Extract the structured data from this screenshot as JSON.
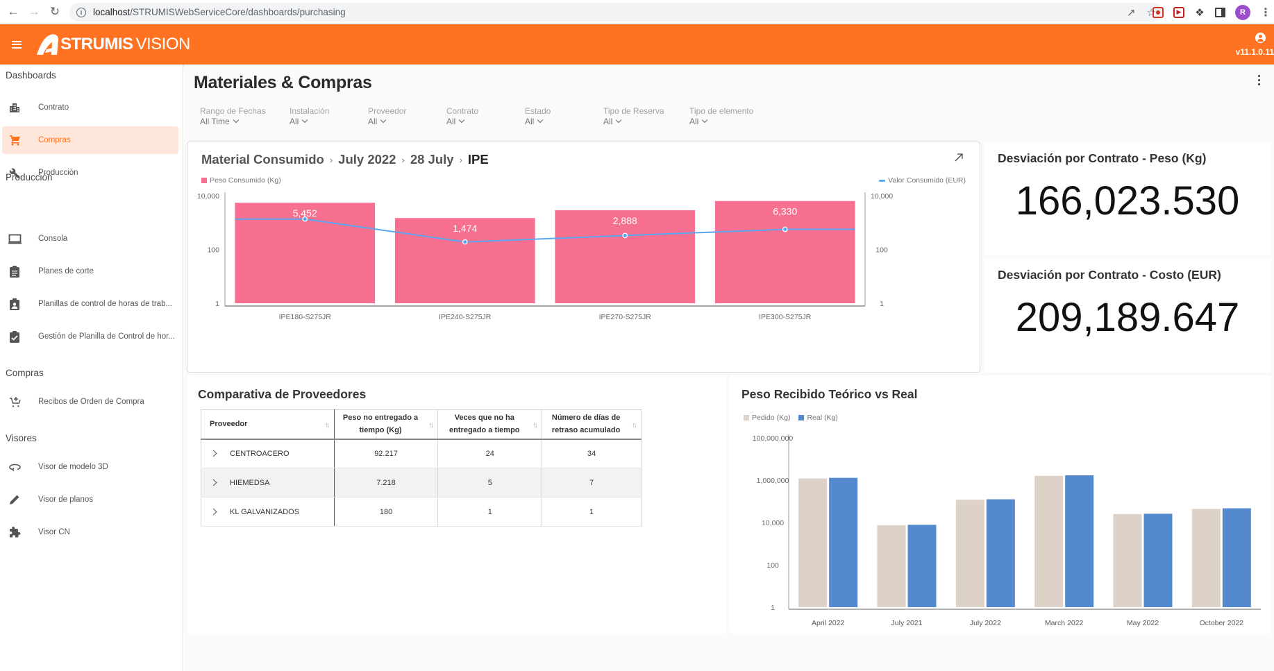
{
  "browser": {
    "url_host": "localhost",
    "url_path": "/STRUMISWebServiceCore/dashboards/purchasing",
    "profile_initial": "R"
  },
  "header": {
    "brand_bold": "STRUMIS",
    "brand_light": "VISION",
    "version": "v11.1.0.11"
  },
  "sidebar": {
    "sections": [
      {
        "label": "Dashboards",
        "items": [
          {
            "label": "Contrato",
            "icon": "building-icon"
          },
          {
            "label": "Compras",
            "icon": "cart-icon",
            "active": true
          },
          {
            "label": "Producción",
            "icon": "wrench-icon"
          }
        ]
      },
      {
        "label": "Producción",
        "items": [
          {
            "label": "Consola",
            "icon": "laptop-icon"
          },
          {
            "label": "Planes de corte",
            "icon": "clipboard-icon"
          },
          {
            "label": "Planillas de control de horas de trab...",
            "icon": "clipboard-user-icon"
          },
          {
            "label": "Gestión de Planilla de Control de hor...",
            "icon": "clipboard-check-icon"
          }
        ]
      },
      {
        "label": "Compras",
        "items": [
          {
            "label": "Recibos de Orden de Compra",
            "icon": "cart-plus-icon"
          }
        ]
      },
      {
        "label": "Visores",
        "items": [
          {
            "label": "Visor de modelo 3D",
            "icon": "rotate-3d-icon"
          },
          {
            "label": "Visor de planos",
            "icon": "pencil-icon"
          },
          {
            "label": "Visor CN",
            "icon": "puzzle-icon"
          }
        ]
      }
    ]
  },
  "page": {
    "title": "Materiales & Compras",
    "filters": [
      {
        "label": "Rango de Fechas",
        "value": "All Time"
      },
      {
        "label": "Instalación",
        "value": "All"
      },
      {
        "label": "Proveedor",
        "value": "All"
      },
      {
        "label": "Contrato",
        "value": "All"
      },
      {
        "label": "Estado",
        "value": "All"
      },
      {
        "label": "Tipo de Reserva",
        "value": "All"
      },
      {
        "label": "Tipo de elemento",
        "value": "All"
      }
    ]
  },
  "material_card": {
    "breadcrumb": [
      "Material Consumido",
      "July 2022",
      "28 July",
      "IPE"
    ]
  },
  "kpis": [
    {
      "title": "Desviación por Contrato - Peso (Kg)",
      "value": "166,023.530"
    },
    {
      "title": "Desviación por Contrato - Costo (EUR)",
      "value": "209,189.647"
    }
  ],
  "suppliers": {
    "title": "Comparativa de Proveedores",
    "columns": [
      "Proveedor",
      "Peso no entregado a tiempo (Kg)",
      "Veces que no ha entregado a tiempo",
      "Número de días de retraso acumulado"
    ],
    "columns_lines": [
      [
        "Proveedor"
      ],
      [
        "Peso no entregado a",
        "tiempo (Kg)"
      ],
      [
        "Veces que no ha",
        "entregado a tiempo"
      ],
      [
        "Número de días de",
        "retraso acumulado"
      ]
    ],
    "rows": [
      [
        "CENTROACERO",
        "92.217",
        "24",
        "34"
      ],
      [
        "HIEMEDSA",
        "7.218",
        "5",
        "7"
      ],
      [
        "KL GALVANIZADOS",
        "180",
        "1",
        "1"
      ]
    ]
  },
  "received_card": {
    "title": "Peso Recibido Teórico vs Real"
  },
  "colors": {
    "accent": "#ff7222",
    "bar_pink": "#f87090",
    "line_blue": "#5aa6f0",
    "pedido": "#ddd2c7",
    "real": "#5589ce"
  },
  "chart_data": [
    {
      "type": "bar",
      "title": "Material Consumido > July 2022 > 28 July > IPE",
      "categories": [
        "IPE180-S275JR",
        "IPE240-S275JR",
        "IPE270-S275JR",
        "IPE300-S275JR"
      ],
      "series": [
        {
          "name": "Peso Consumido (Kg)",
          "type": "bar",
          "axis": "left",
          "values": [
            5452,
            1474,
            2888,
            6330
          ],
          "labels": [
            "5,452",
            "1,474",
            "2,888",
            "6,330"
          ]
        },
        {
          "name": "Valor Consumido (EUR)",
          "type": "line",
          "axis": "right",
          "values": [
            1350,
            190,
            330,
            560
          ]
        }
      ],
      "yscale": "log",
      "yticks": [
        "1",
        "100",
        "10,000"
      ],
      "ylim": [
        1,
        10000
      ],
      "y2ticks": [
        "1",
        "100",
        "10,000"
      ],
      "y2lim": [
        1,
        10000
      ],
      "legend": [
        "top-left: Peso Consumido (Kg)",
        "top-right: Valor Consumido (EUR)"
      ],
      "grid": false
    },
    {
      "type": "bar",
      "title": "Peso Recibido Teórico vs Real",
      "categories": [
        "April 2022",
        "July 2021",
        "July 2022",
        "March 2022",
        "May 2022",
        "October 2022"
      ],
      "series": [
        {
          "name": "Pedido (Kg)",
          "values": [
            1200000,
            7400,
            120000,
            1600000,
            25000,
            44000
          ]
        },
        {
          "name": "Real (Kg)",
          "values": [
            1290000,
            7800,
            125000,
            1700000,
            26000,
            47000
          ]
        }
      ],
      "yscale": "log",
      "yticks": [
        "1",
        "100",
        "10,000",
        "1,000,000",
        "100,000,000"
      ],
      "ylim": [
        1,
        100000000
      ],
      "legend": "top-left",
      "grid": false
    }
  ]
}
